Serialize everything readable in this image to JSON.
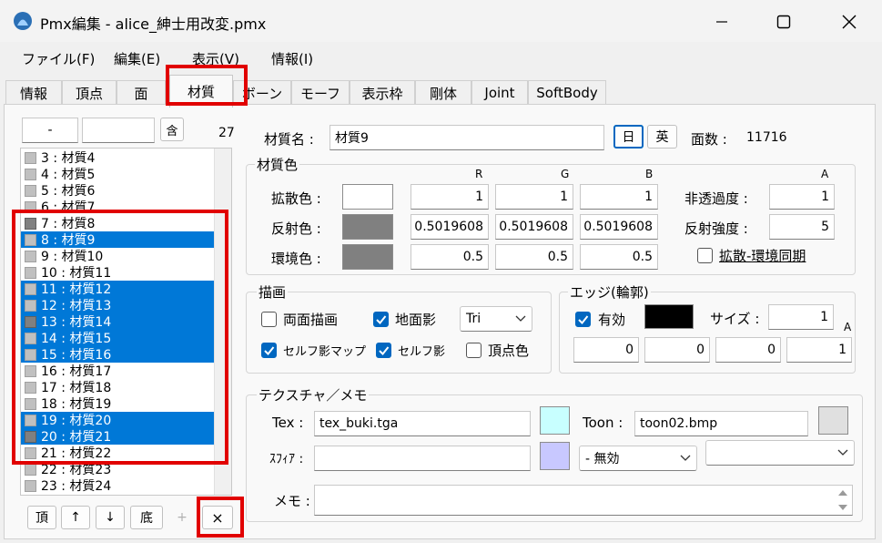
{
  "window": {
    "title": "Pmx編集 - alice_紳士用改変.pmx"
  },
  "menu": [
    "ファイル(F)",
    "編集(E)",
    "表示(V)",
    "情報(I)"
  ],
  "tabs": [
    "情報",
    "頂点",
    "面",
    "材質",
    "ボーン",
    "モーフ",
    "表示枠",
    "剛体",
    "Joint",
    "SoftBody"
  ],
  "active_tab": "材質",
  "search": {
    "field1": "-",
    "field2": "",
    "button": "含",
    "count": "27"
  },
  "material_list": [
    {
      "label": "3 : 材質4",
      "selected": false,
      "dark": false
    },
    {
      "label": "4 : 材質5",
      "selected": false,
      "dark": false
    },
    {
      "label": "5 : 材質6",
      "selected": false,
      "dark": false
    },
    {
      "label": "6 : 材質7",
      "selected": false,
      "dark": false
    },
    {
      "label": "7 : 材質8",
      "selected": false,
      "dark": true
    },
    {
      "label": "8 : 材質9",
      "selected": true,
      "dark": false
    },
    {
      "label": "9 : 材質10",
      "selected": false,
      "dark": false
    },
    {
      "label": "10 : 材質11",
      "selected": false,
      "dark": false
    },
    {
      "label": "11 : 材質12",
      "selected": true,
      "dark": false
    },
    {
      "label": "12 : 材質13",
      "selected": true,
      "dark": false
    },
    {
      "label": "13 : 材質14",
      "selected": true,
      "dark": true
    },
    {
      "label": "14 : 材質15",
      "selected": true,
      "dark": false
    },
    {
      "label": "15 : 材質16",
      "selected": true,
      "dark": false
    },
    {
      "label": "16 : 材質17",
      "selected": false,
      "dark": false
    },
    {
      "label": "17 : 材質18",
      "selected": false,
      "dark": false
    },
    {
      "label": "18 : 材質19",
      "selected": false,
      "dark": false
    },
    {
      "label": "19 : 材質20",
      "selected": true,
      "dark": false
    },
    {
      "label": "20 : 材質21",
      "selected": true,
      "dark": true
    },
    {
      "label": "21 : 材質22",
      "selected": false,
      "dark": false
    },
    {
      "label": "22 : 材質23",
      "selected": false,
      "dark": false
    },
    {
      "label": "23 : 材質24",
      "selected": false,
      "dark": false
    }
  ],
  "list_buttons": {
    "top": "頂",
    "up": "↑",
    "down": "↓",
    "bottom": "底",
    "add": "+",
    "delete": "×"
  },
  "material": {
    "name_label": "材質名 :",
    "name_value": "材質9",
    "lang_jp": "日",
    "lang_en": "英",
    "face_count_label": "面数 :",
    "face_count": "11716"
  },
  "color_group": {
    "title": "材質色",
    "headers": {
      "r": "R",
      "g": "G",
      "b": "B",
      "a": "A"
    },
    "diffuse": {
      "label": "拡散色 :",
      "r": "1",
      "g": "1",
      "b": "1",
      "swatch": "#ffffff"
    },
    "specular": {
      "label": "反射色 :",
      "r": "0.5019608",
      "g": "0.5019608",
      "b": "0.5019608",
      "swatch": "#808080"
    },
    "ambient": {
      "label": "環境色 :",
      "r": "0.5",
      "g": "0.5",
      "b": "0.5",
      "swatch": "#808080"
    },
    "opacity": {
      "label": "非透過度 :",
      "value": "1"
    },
    "specular_power": {
      "label": "反射強度 :",
      "value": "5"
    },
    "sync": {
      "label": "拡散-環境同期",
      "checked": false
    }
  },
  "draw_group": {
    "title": "描画",
    "double_sided": {
      "label": "両面描画",
      "checked": false
    },
    "ground_shadow": {
      "label": "地面影",
      "checked": true
    },
    "shadow_type": "Tri",
    "self_shadow_map": {
      "label": "セルフ影マップ",
      "checked": true
    },
    "self_shadow": {
      "label": "セルフ影",
      "checked": true
    },
    "vertex_color": {
      "label": "頂点色",
      "checked": false
    }
  },
  "edge_group": {
    "title": "エッジ(輪郭)",
    "enabled": {
      "label": "有効",
      "checked": true
    },
    "color": "#000000",
    "size_label": "サイズ :",
    "size": "1",
    "a_header": "A",
    "rgba": [
      "0",
      "0",
      "0",
      "1"
    ]
  },
  "texture_group": {
    "title": "テクスチャ／メモ",
    "tex_label": "Tex :",
    "tex_value": "tex_buki.tga",
    "tex_color": "#c8ffff",
    "toon_label": "Toon :",
    "toon_value": "toon02.bmp",
    "toon_color": "#e0e0e0",
    "sphere_label": "ｽﾌｨｱ :",
    "sphere_value": "",
    "sphere_color": "#c8c8ff",
    "sphere_mode": "- 無効",
    "sphere_extra": "",
    "memo_label": "メモ :",
    "memo_value": ""
  }
}
